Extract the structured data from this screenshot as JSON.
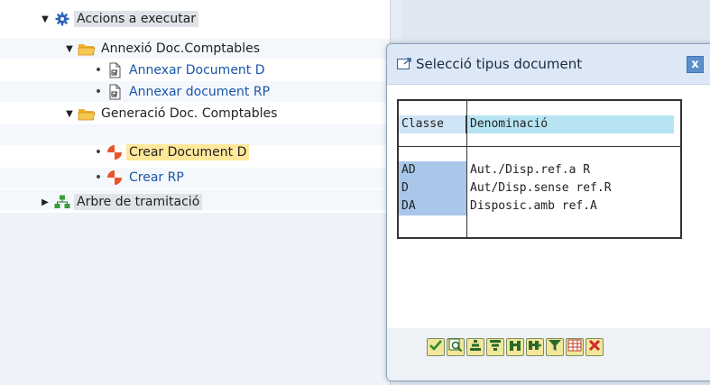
{
  "tree": {
    "nodes": [
      {
        "label": "Accions a executar"
      },
      {
        "label": "Annexió Doc.Comptables"
      },
      {
        "label": "Annexar Document D"
      },
      {
        "label": "Annexar document RP"
      },
      {
        "label": "Generació Doc. Comptables"
      },
      {
        "label": "Crear Document D"
      },
      {
        "label": "Crear RP"
      },
      {
        "label": "Arbre de tramitació"
      }
    ]
  },
  "dialog": {
    "title": "Selecció tipus document",
    "close_symbol": "x",
    "table": {
      "headers": [
        "Classe",
        "Denominació"
      ],
      "rows": [
        {
          "code": "AD",
          "name": "Aut./Disp.ref.a R"
        },
        {
          "code": "D",
          "name": "Aut/Disp.sense ref.R"
        },
        {
          "code": "DA",
          "name": "Disposic.amb ref.A"
        }
      ]
    },
    "toolbar": [
      {
        "icon": "checkmark-icon"
      },
      {
        "icon": "find-icon"
      },
      {
        "icon": "sort-ascending-icon"
      },
      {
        "icon": "sort-descending-icon"
      },
      {
        "icon": "binoculars-icon"
      },
      {
        "icon": "binoculars-next-icon"
      },
      {
        "icon": "filter-icon"
      },
      {
        "icon": "layout-grid-icon"
      },
      {
        "icon": "cancel-icon"
      }
    ]
  },
  "colors": {
    "selected_highlight": "#ffe89a",
    "link_text": "#1a55a8",
    "header_cell": "#b6e4f2",
    "key_cell": "#a9c7ea"
  }
}
